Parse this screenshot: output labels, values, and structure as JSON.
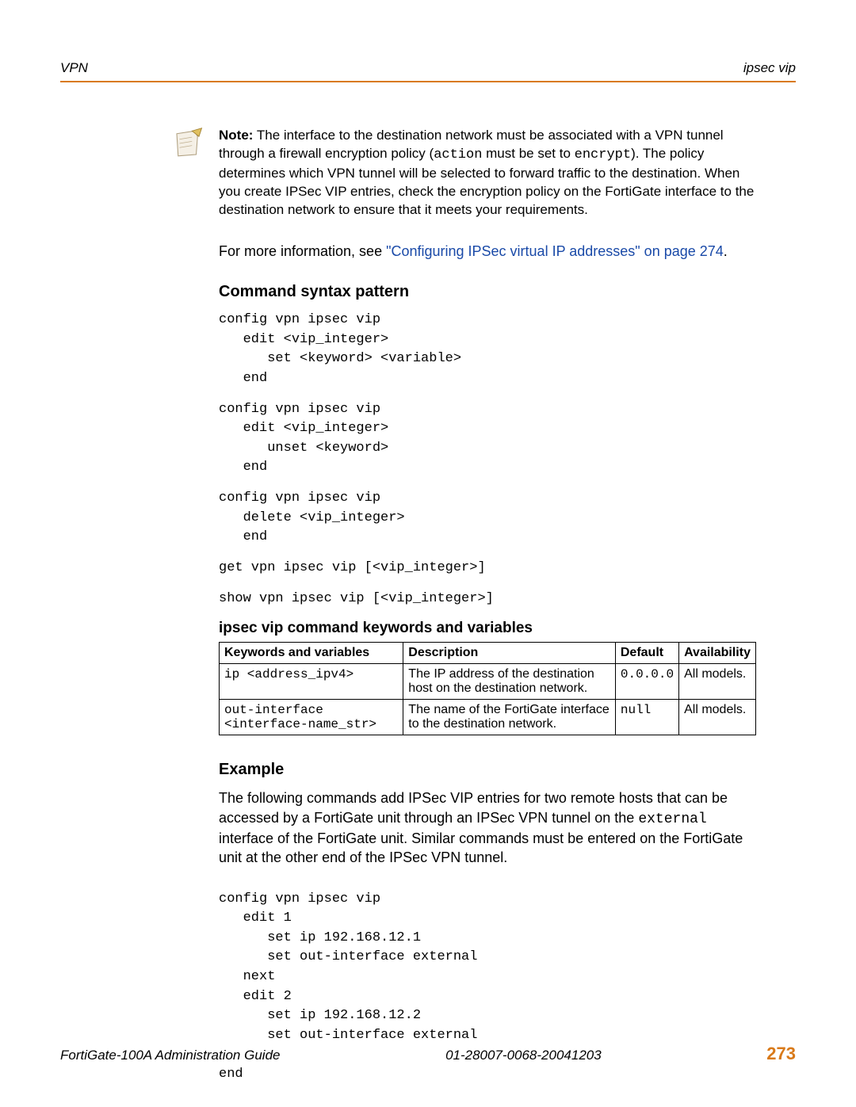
{
  "header": {
    "left": "VPN",
    "right": "ipsec vip"
  },
  "note": {
    "prefix": "Note:",
    "body_a": " The interface to the destination network must be associated with a VPN tunnel through a firewall encryption policy (",
    "code1": "action",
    "body_b": " must be set to ",
    "code2": "encrypt",
    "body_c": "). The policy determines which VPN tunnel will be selected to forward traffic to the destination. When you create IPSec VIP entries, check the encryption policy on the FortiGate interface to the destination network to ensure that it meets your requirements."
  },
  "more_info": {
    "prefix": "For more information, see ",
    "link": "\"Configuring IPSec virtual IP addresses\" on page 274",
    "suffix": "."
  },
  "sections": {
    "syntax_heading": "Command syntax pattern",
    "table_heading": "ipsec vip command keywords and variables",
    "example_heading": "Example"
  },
  "syntax": {
    "block1": "config vpn ipsec vip\n   edit <vip_integer>\n      set <keyword> <variable>\n   end",
    "block2": "config vpn ipsec vip\n   edit <vip_integer>\n      unset <keyword>\n   end",
    "block3": "config vpn ipsec vip\n   delete <vip_integer>\n   end",
    "block4": "get vpn ipsec vip [<vip_integer>]",
    "block5": "show vpn ipsec vip [<vip_integer>]"
  },
  "table": {
    "headers": [
      "Keywords and variables",
      "Description",
      "Default",
      "Availability"
    ],
    "rows": [
      {
        "kv": "ip <address_ipv4>",
        "desc": "The IP address of the destination host on the destination network.",
        "default": "0.0.0.0",
        "avail": "All models."
      },
      {
        "kv": "out-interface <interface-name_str>",
        "desc": "The name of the FortiGate interface to the destination network.",
        "default": "null",
        "avail": "All models."
      }
    ]
  },
  "example": {
    "para_a": "The following commands add IPSec VIP entries for two remote hosts that can be accessed by a FortiGate unit through an IPSec VPN tunnel on the ",
    "code": "external",
    "para_b": " interface of the FortiGate unit. Similar commands must be entered on the FortiGate unit at the other end of the IPSec VPN tunnel.",
    "code_block": "config vpn ipsec vip\n   edit 1\n      set ip 192.168.12.1\n      set out-interface external\n   next\n   edit 2\n      set ip 192.168.12.2\n      set out-interface external\n\nend"
  },
  "footer": {
    "left": "FortiGate-100A Administration Guide",
    "mid": "01-28007-0068-20041203",
    "page": "273"
  }
}
